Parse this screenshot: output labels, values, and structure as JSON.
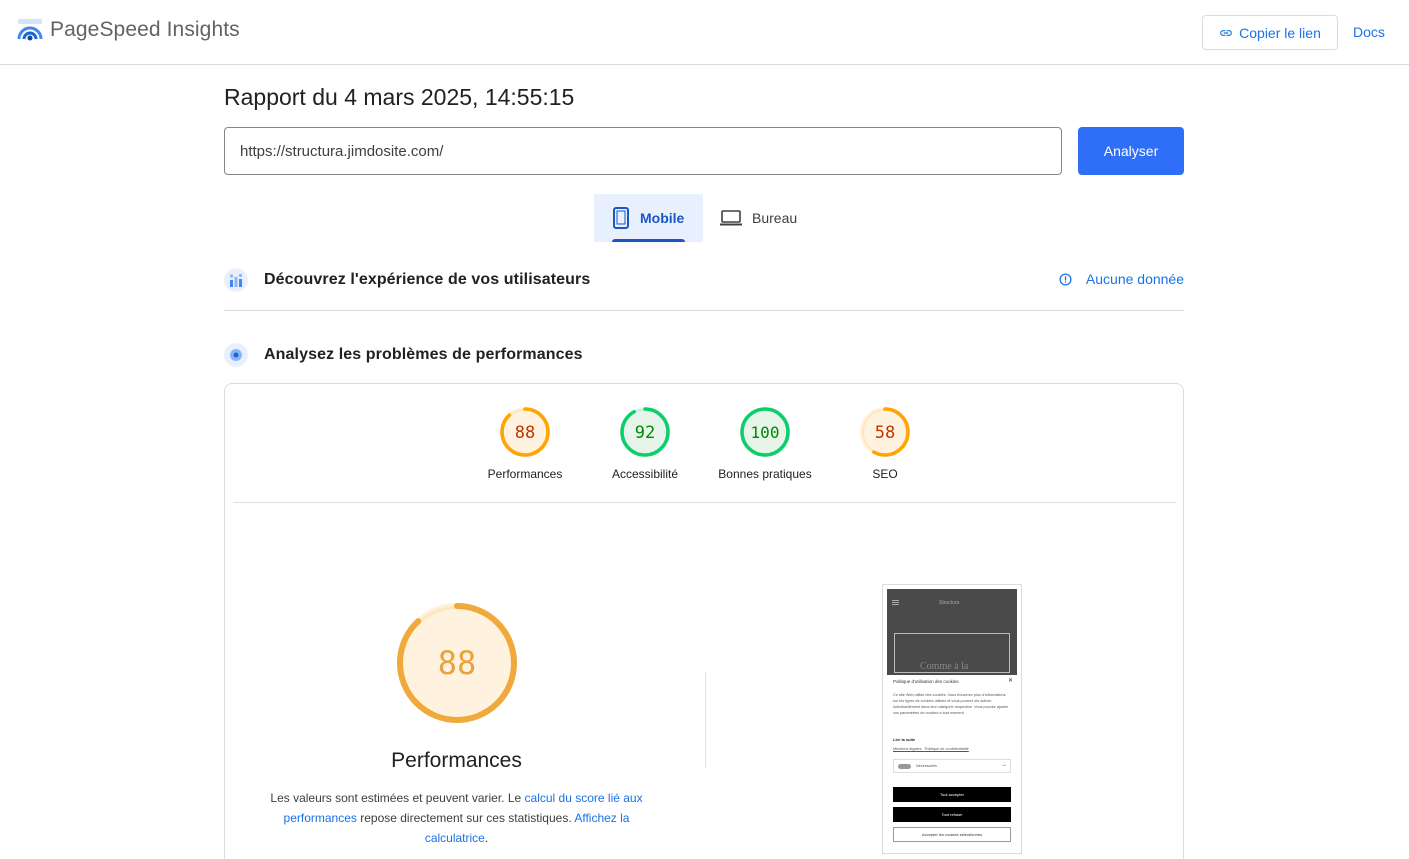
{
  "header": {
    "app_name": "PageSpeed Insights",
    "copy_link_label": "Copier le lien",
    "docs_label": "Docs"
  },
  "report": {
    "title": "Rapport du 4 mars 2025, 14:55:15"
  },
  "search": {
    "url_value": "https://structura.jimdosite.com/",
    "analyze_label": "Analyser"
  },
  "tabs": [
    {
      "label": "Mobile",
      "active": true
    },
    {
      "label": "Bureau",
      "active": false
    }
  ],
  "sections": {
    "field_data": {
      "title": "Découvrez l'expérience de vos utilisateurs",
      "status_label": "Aucune donnée"
    },
    "lab_data": {
      "title": "Analysez les problèmes de performances"
    }
  },
  "scores": [
    {
      "label": "Performances",
      "value": "88",
      "rating": "average"
    },
    {
      "label": "Accessibilité",
      "value": "92",
      "rating": "good"
    },
    {
      "label": "Bonnes pratiques",
      "value": "100",
      "rating": "good"
    },
    {
      "label": "SEO",
      "value": "58",
      "rating": "average"
    }
  ],
  "colors": {
    "good": "#0cce6b",
    "good_text": "#008800",
    "average": "#ffa400",
    "average_text": "#c33300",
    "average_bg": "#fff3e0",
    "good_bg": "#e6f4ea",
    "accent": "#1a73e8",
    "primary_button": "#2f6ff7"
  },
  "performance_detail": {
    "score": "88",
    "title": "Performances",
    "desc_part1": "Les valeurs sont estimées et peuvent varier. Le ",
    "desc_link1": "calcul du score lié aux performances",
    "desc_part2": " repose directement sur ces statistiques. ",
    "desc_link2": "Affichez la calculatrice",
    "desc_part3": "."
  },
  "screenshot": {
    "site_brand": "Structura",
    "hero_text": "Comme à la",
    "cookie_title": "Politique d'utilisation des cookies",
    "cookie_body": "Ce site Web utilise des cookies. Vous trouverez plus d'informations sur les types de cookies utilisés et vous pourrez les activer individuellement dans leur catégorie respective. Vous pouvez ajuster vos paramètres de cookies à tout moment.",
    "read_more": "Lire la suite",
    "link_legal": "Mentions légales",
    "link_privacy": "Politique de confidentialité",
    "toggle_label": "Nécessaires",
    "accept_all": "Tout accepter",
    "reject_all": "Tout refuser",
    "accept_selected": "Accepter les cookies sélectionnés"
  }
}
